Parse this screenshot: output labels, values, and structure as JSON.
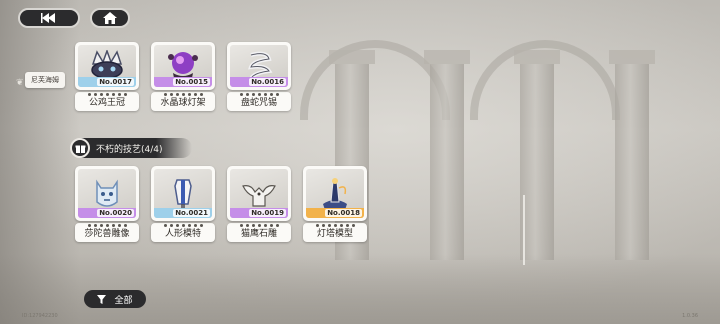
{
  "nav": {
    "back_icon": "rewind-icon",
    "home_icon": "home-icon"
  },
  "side_tag": "尼芙海姆",
  "rows": [
    {
      "cards": [
        {
          "no": "No.0017",
          "name": "公鸡王冠",
          "strip_color": "#9ed0ea"
        },
        {
          "no": "No.0015",
          "name": "水晶球灯架",
          "strip_color": "#c58ee8"
        },
        {
          "no": "No.0016",
          "name": "盘蛇咒锡",
          "strip_color": "#c58ee8"
        }
      ]
    },
    {
      "cards": [
        {
          "no": "No.0020",
          "name": "莎陀兽雕像",
          "strip_color": "#c58ee8"
        },
        {
          "no": "No.0021",
          "name": "人形模特",
          "strip_color": "#9ed0ea"
        },
        {
          "no": "No.0019",
          "name": "猫鹰石雕",
          "strip_color": "#c58ee8"
        },
        {
          "no": "No.0018",
          "name": "灯塔模型",
          "strip_color": "#f2b24a"
        }
      ]
    }
  ],
  "section": {
    "title": "不朽的技艺(4/4)"
  },
  "filter": {
    "label": "全部"
  },
  "footer": {
    "id": "ID:127942230",
    "version": "1.0.36"
  }
}
